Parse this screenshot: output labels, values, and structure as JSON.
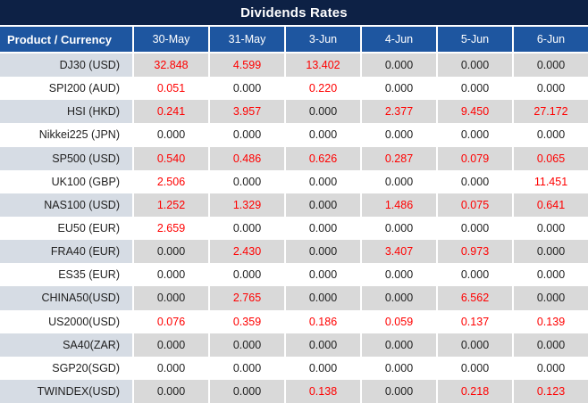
{
  "title": "Dividends Rates",
  "columns": [
    "Product / Currency",
    "30-May",
    "31-May",
    "3-Jun",
    "4-Jun",
    "5-Jun",
    "6-Jun"
  ],
  "rows": [
    {
      "product": "DJ30 (USD)",
      "values": [
        "32.848",
        "4.599",
        "13.402",
        "0.000",
        "0.000",
        "0.000"
      ]
    },
    {
      "product": "SPI200 (AUD)",
      "values": [
        "0.051",
        "0.000",
        "0.220",
        "0.000",
        "0.000",
        "0.000"
      ]
    },
    {
      "product": "HSI (HKD)",
      "values": [
        "0.241",
        "3.957",
        "0.000",
        "2.377",
        "9.450",
        "27.172"
      ]
    },
    {
      "product": "Nikkei225 (JPN)",
      "values": [
        "0.000",
        "0.000",
        "0.000",
        "0.000",
        "0.000",
        "0.000"
      ]
    },
    {
      "product": "SP500 (USD)",
      "values": [
        "0.540",
        "0.486",
        "0.626",
        "0.287",
        "0.079",
        "0.065"
      ]
    },
    {
      "product": "UK100 (GBP)",
      "values": [
        "2.506",
        "0.000",
        "0.000",
        "0.000",
        "0.000",
        "11.451"
      ]
    },
    {
      "product": "NAS100 (USD)",
      "values": [
        "1.252",
        "1.329",
        "0.000",
        "1.486",
        "0.075",
        "0.641"
      ]
    },
    {
      "product": "EU50 (EUR)",
      "values": [
        "2.659",
        "0.000",
        "0.000",
        "0.000",
        "0.000",
        "0.000"
      ]
    },
    {
      "product": "FRA40 (EUR)",
      "values": [
        "0.000",
        "2.430",
        "0.000",
        "3.407",
        "0.973",
        "0.000"
      ]
    },
    {
      "product": "ES35 (EUR)",
      "values": [
        "0.000",
        "0.000",
        "0.000",
        "0.000",
        "0.000",
        "0.000"
      ]
    },
    {
      "product": "CHINA50(USD)",
      "values": [
        "0.000",
        "2.765",
        "0.000",
        "0.000",
        "6.562",
        "0.000"
      ]
    },
    {
      "product": "US2000(USD)",
      "values": [
        "0.076",
        "0.359",
        "0.186",
        "0.059",
        "0.137",
        "0.139"
      ]
    },
    {
      "product": "SA40(ZAR)",
      "values": [
        "0.000",
        "0.000",
        "0.000",
        "0.000",
        "0.000",
        "0.000"
      ]
    },
    {
      "product": "SGP20(SGD)",
      "values": [
        "0.000",
        "0.000",
        "0.000",
        "0.000",
        "0.000",
        "0.000"
      ]
    },
    {
      "product": "TWINDEX(USD)",
      "values": [
        "0.000",
        "0.000",
        "0.138",
        "0.000",
        "0.218",
        "0.123"
      ]
    }
  ],
  "colors": {
    "title_bg": "#0d2145",
    "header_bg": "#1e56a0",
    "row_alt_bg": "#d9d9d9",
    "row_alt_product_bg": "#d6dce4",
    "zero_text": "#212121",
    "nonzero_text": "#ff0000"
  }
}
